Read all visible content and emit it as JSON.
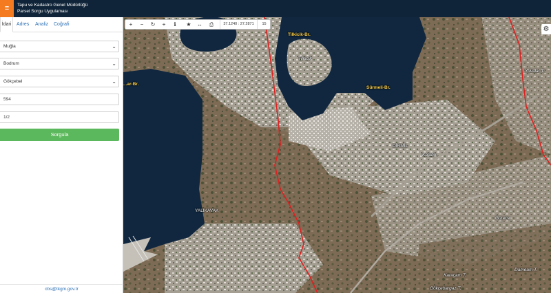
{
  "header": {
    "menu_icon": "hamburger-icon",
    "title_line1": "Tapu ve Kadastro Genel Müdürlüğü",
    "title_line2": "Parsel Sorgu Uygulaması"
  },
  "sidebar": {
    "tabs": [
      {
        "label": "İdari"
      },
      {
        "label": "Adres"
      },
      {
        "label": "Analiz"
      },
      {
        "label": "Coğrafi"
      }
    ],
    "form": {
      "province": "Muğla",
      "district": "Bodrum",
      "neighborhood": "Gökçebel",
      "block": "594",
      "parcel": "1/2",
      "query_button": "Sorgula"
    },
    "footer_link": "cbs@tkgm.gov.tr"
  },
  "map": {
    "toolbar": {
      "icons": [
        "zoom-in-icon",
        "zoom-out-icon",
        "refresh-icon",
        "locate-icon",
        "info-icon",
        "star-icon",
        "measure-icon",
        "print-icon"
      ],
      "coordinates": "37.1240 : 27.2871",
      "zoom_level": "15"
    },
    "settings_icon": "gear-icon",
    "labels": {
      "tilkicik_br": "Tilkicik-Br.",
      "tilkicik": "Tilkicik",
      "surmeli_br": "Sürmeli-Br.",
      "br_left": "...ar-Br.",
      "dirmil": "DİRMİL",
      "kalabo": "Kalabo",
      "yalikavak": "YALIKAVAK",
      "gurece": "Gürece",
      "yuvalar_t": "Yuvalar T.",
      "karacam_t": "Karaçam T.",
      "dumeam_t": "Dameam T.",
      "gokcebargaz_t": "Gökçebargaz T."
    }
  }
}
